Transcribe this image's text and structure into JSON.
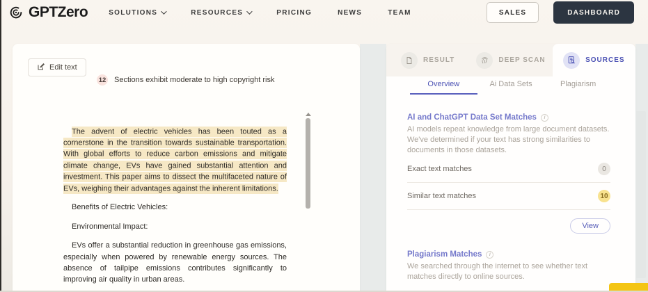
{
  "nav": {
    "brand": "GPTZero",
    "items": [
      {
        "label": "SOLUTIONS",
        "has_dropdown": true
      },
      {
        "label": "RESOURCES",
        "has_dropdown": true
      },
      {
        "label": "PRICING",
        "has_dropdown": false
      },
      {
        "label": "NEWS",
        "has_dropdown": false
      },
      {
        "label": "TEAM",
        "has_dropdown": false
      }
    ],
    "sales_label": "SALES",
    "dashboard_label": "DASHBOARD"
  },
  "editor": {
    "edit_button_label": "Edit text",
    "risk_count": "12",
    "risk_text": "Sections exhibit moderate to high copyright risk",
    "highlighted_paragraph": "The advent of electric vehicles has been touted as a cornerstone in the transition towards sustainable transportation. With global efforts to reduce carbon emissions and mitigate climate change, EVs have gained substantial attention and investment. This paper aims to dissect the multifaceted nature of EVs, weighing their advantages against the inherent limitations.",
    "heading_benefits": "Benefits of Electric Vehicles:",
    "heading_environmental": "Environmental Impact:",
    "paragraph_evs": "EVs offer a substantial reduction in greenhouse gas emissions, especially when powered by renewable energy sources. The absence of tailpipe emissions contributes significantly to improving air quality in urban areas."
  },
  "results_panel": {
    "tabs": [
      {
        "label": "RESULT",
        "icon": "document-icon",
        "active": false
      },
      {
        "label": "DEEP SCAN",
        "icon": "fingerprint-icon",
        "active": false
      },
      {
        "label": "SOURCES",
        "icon": "document-search-icon",
        "active": true
      }
    ],
    "subtabs": [
      {
        "label": "Overview",
        "active": true
      },
      {
        "label": "Ai Data Sets",
        "active": false
      },
      {
        "label": "Plagiarism",
        "active": false
      }
    ],
    "ai_section": {
      "title": "AI and ChatGPT Data Set Matches",
      "description": "AI models repeat knowledge from large document datasets. We've determined if your text has strong similarities to documents in those datasets.",
      "rows": [
        {
          "label": "Exact text matches",
          "value": "0",
          "badge_style": "gray"
        },
        {
          "label": "Similar text matches",
          "value": "10",
          "badge_style": "yellow"
        }
      ],
      "view_button_label": "View"
    },
    "plagiarism_section": {
      "title": "Plagiarism Matches",
      "description": "We searched through the internet to see whether text matches directly to online sources."
    }
  },
  "colors": {
    "accent_indigo": "#4c52b4",
    "title_purple": "#7579cb",
    "highlight_yellow": "#f6e8c5",
    "badge_yellow_bg": "#f8e28f",
    "badge_gray_bg": "#eae7e2",
    "risk_badge_bg": "#f9e3de",
    "dashboard_button_bg": "#2c3541",
    "page_background": "#f7f2ec",
    "chat_button_yellow": "#f4c513"
  }
}
